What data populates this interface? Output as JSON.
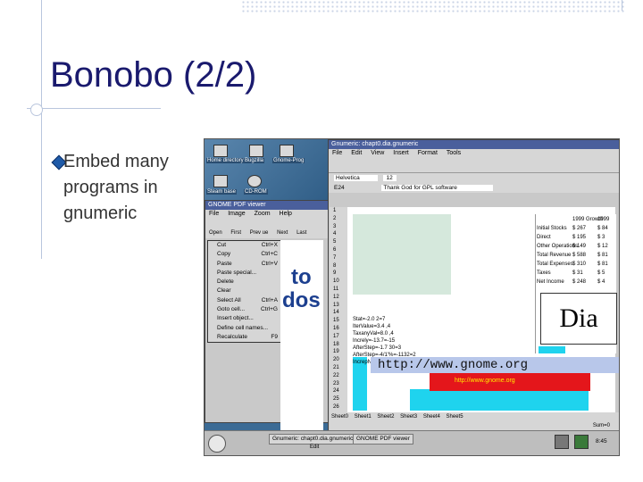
{
  "slide": {
    "title": "Bonobo (2/2)",
    "bullet": "Embed many programs in gnumeric"
  },
  "desktop": {
    "icons": [
      "Home directory",
      "Bugzilla",
      "Gnome-Prog",
      "Steam base",
      "CD-ROM"
    ]
  },
  "pdf_viewer": {
    "title": "GNOME PDF viewer",
    "menu": [
      "File",
      "Image",
      "Zoom",
      "Help"
    ],
    "tools": [
      "Open",
      "First",
      "Prev ue",
      "Next",
      "Last"
    ],
    "big_text": [
      "to",
      "dos"
    ],
    "context_menu": [
      {
        "label": "Cut",
        "shortcut": "Ctrl+X"
      },
      {
        "label": "Copy",
        "shortcut": "Ctrl+C"
      },
      {
        "label": "Paste",
        "shortcut": "Ctrl+V"
      },
      {
        "label": "Paste special...",
        "shortcut": ""
      },
      {
        "label": "Delete",
        "shortcut": ""
      },
      {
        "label": "Clear",
        "shortcut": ""
      },
      {
        "label": "Select All",
        "shortcut": "Ctrl+A"
      },
      {
        "label": "Goto cell...",
        "shortcut": "Ctrl+G"
      },
      {
        "label": "Insert object...",
        "shortcut": ""
      },
      {
        "label": "Define cell names...",
        "shortcut": ""
      },
      {
        "label": "Recalculate",
        "shortcut": "F9"
      }
    ]
  },
  "gnumeric": {
    "title": "Gnumeric: chapt0.dia.gnumeric",
    "menu": [
      "File",
      "Edit",
      "View",
      "Insert",
      "Format",
      "Tools"
    ],
    "font": "Helvetica",
    "font_size": "12",
    "cell_ref": "E24",
    "formula": "Thank God for GPL software",
    "finance": {
      "header": [
        "",
        "1999 Growth",
        "1999"
      ],
      "rows": [
        [
          "Initial Stocks",
          "$ 267",
          "$ 84"
        ],
        [
          "Direct",
          "$ 195",
          "$ 3"
        ],
        [
          "Other Operations",
          "$ 149",
          "$ 12"
        ],
        [
          "Total Revenue",
          "$ 588",
          "$ 81"
        ],
        [
          "Total Expenses",
          "$ 310",
          "$ 81"
        ],
        [
          "Taxes",
          "$ 31",
          "$ 5"
        ],
        [
          "Net Income",
          "$ 248",
          "$ 4"
        ]
      ]
    },
    "code": [
      "Stat=-2.0 2=7",
      "IterValue=3.4 ,4",
      "TaxanyVal=8.0 ,4",
      "Increly=-13.7=-15",
      "AfterStep=-1.7 30=3",
      "AfterStep=-4/1'%=-1132=2",
      "IncrepNo=2.0=1"
    ],
    "url_text": "http://www.gnome.org",
    "dia_text": "Dia",
    "sheet_tabs": [
      "Sheet0",
      "Sheet1",
      "Sheet2",
      "Sheet3",
      "Sheet4",
      "Sheet5"
    ],
    "status": "Sum=0",
    "row_numbers": [
      "1",
      "2",
      "3",
      "4",
      "5",
      "6",
      "7",
      "8",
      "9",
      "10",
      "11",
      "12",
      "13",
      "14",
      "15",
      "16",
      "17",
      "18",
      "19",
      "20",
      "21",
      "22",
      "23",
      "24",
      "25",
      "26"
    ]
  },
  "taskbar": {
    "items": [
      "Gnumeric: chapt0.dia.gnumeric",
      "GNOME PDF viewer"
    ],
    "sub": "Edit",
    "clock": "8:45"
  },
  "colors": {
    "title": "#1a1a6e",
    "bullet": "#1e5aa8",
    "url_band": "#b8c7ea",
    "red_band": "#e4161b",
    "cyan": "#1fd3ee"
  }
}
